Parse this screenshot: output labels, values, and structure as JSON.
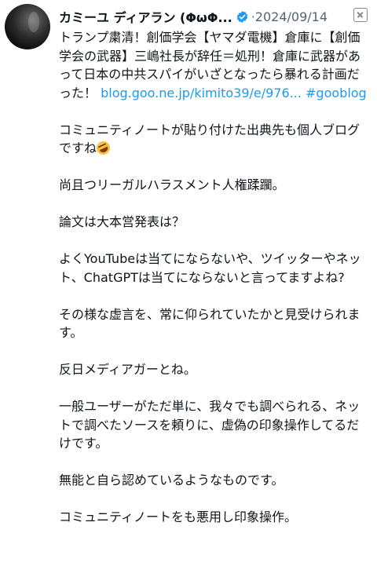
{
  "post": {
    "author_name": "カミーユ ディアラン (ΦωΦ...",
    "separator": "·",
    "date": "2024/09/14",
    "quote_text": "トランプ粛清！創価学会【ヤマダ電機】倉庫に【創価学会の武器】三嶋社長が辞任＝処刑！倉庫に武器があって日本の中共スパイがいざとなったら暴れる計画だった！ ",
    "quote_link": "blog.goo.ne.jp/kimito39/e/976...",
    "quote_hashtag": "#gooblog",
    "paragraph_2": "コミュニティノートが貼り付けた出典先も個人ブログですね",
    "paragraph_3": "尚且つリーガルハラスメント人権蹂躙。",
    "paragraph_4": "論文は大本営発表は？",
    "paragraph_5": "よくYouTubeは当てにならないや、ツイッターやネット、ChatGPTは当てにならないと言ってますよね?",
    "paragraph_6": "その様な虚言を、常に仰られていたかと見受けられます。",
    "paragraph_7": "反日メディアガーとね。",
    "paragraph_8": "一般ユーザーがただ単に、我々でも調べられる、ネットで調べたソースを頼りに、虚偽の印象操作してるだけです。",
    "paragraph_9": "無能と自ら認めているようなものです。",
    "paragraph_10": "コミュニティノートをも悪用し印象操作。"
  },
  "icons": {
    "verified": "verified-badge-icon",
    "emoji": "rolling-laughing-emoji",
    "more": "more-options-icon"
  },
  "colors": {
    "link": "#1d9bf0",
    "verified": "#1d9bf0",
    "muted": "#536471",
    "text": "#0f1419"
  }
}
